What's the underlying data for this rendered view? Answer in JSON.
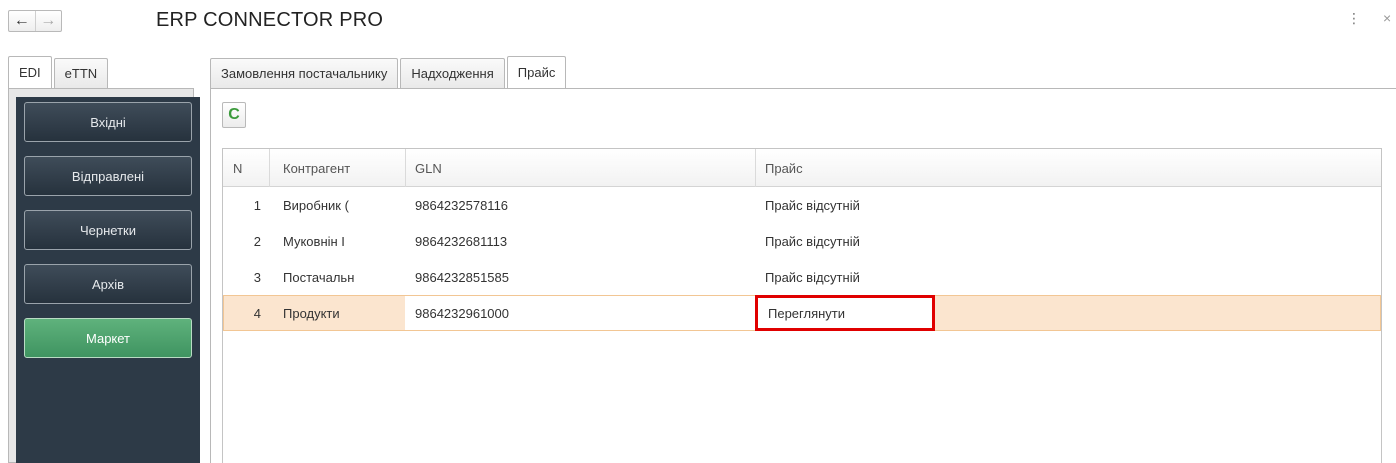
{
  "window": {
    "title": "ERP CONNECTOR PRO",
    "back_icon": "arrow-left-icon",
    "forward_icon": "arrow-right-icon",
    "menu_icon": "kebab-menu-icon",
    "close_icon": "close-icon"
  },
  "left_tabs": [
    {
      "label": "EDI",
      "active": true
    },
    {
      "label": "eTTN",
      "active": false
    }
  ],
  "sidebar": {
    "items": [
      {
        "label": "Вхідні"
      },
      {
        "label": "Відправлені"
      },
      {
        "label": "Чернетки"
      },
      {
        "label": "Архів"
      },
      {
        "label": "Маркет",
        "active": true
      }
    ]
  },
  "main_tabs": [
    {
      "label": "Замовлення постачальнику",
      "active": false
    },
    {
      "label": "Надходження",
      "active": false
    },
    {
      "label": "Прайс",
      "active": true
    }
  ],
  "toolbar": {
    "refresh_icon": "refresh-icon",
    "refresh_glyph": "C"
  },
  "table": {
    "columns": [
      "N",
      "Контрагент",
      "GLN",
      "Прайс"
    ],
    "rows": [
      {
        "n": "1",
        "counterparty": "Виробник (",
        "gln": "9864232578116",
        "price": "Прайс відсутній"
      },
      {
        "n": "2",
        "counterparty": "Муковнін І",
        "gln": "9864232681113",
        "price": "Прайс відсутній"
      },
      {
        "n": "3",
        "counterparty": "Постачальн",
        "gln": "9864232851585",
        "price": "Прайс відсутній"
      },
      {
        "n": "4",
        "counterparty": "Продукти",
        "gln": "9864232961000",
        "price": "Переглянути",
        "selected": true
      }
    ]
  },
  "colors": {
    "sidebar_bg": "#2d3a47",
    "market_button": "#4fa36e",
    "selected_row": "#fbe5cf",
    "highlight_border": "#e00000",
    "refresh_icon": "#3b9a3b"
  }
}
